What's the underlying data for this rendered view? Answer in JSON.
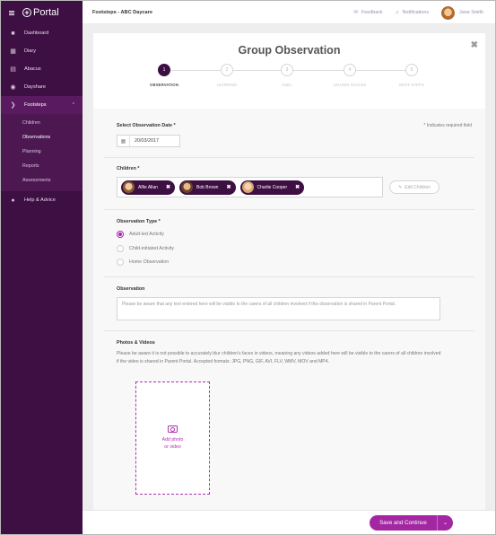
{
  "app": {
    "logo_text": "Portal"
  },
  "sidebar": {
    "items": [
      {
        "label": "Dashboard",
        "icon": "dashboard-icon"
      },
      {
        "label": "Diary",
        "icon": "calendar-icon"
      },
      {
        "label": "Abacus",
        "icon": "abacus-icon"
      },
      {
        "label": "Dayshare",
        "icon": "dayshare-icon"
      },
      {
        "label": "Footsteps",
        "icon": "footsteps-icon"
      },
      {
        "label": "Help & Advice",
        "icon": "help-icon"
      }
    ],
    "footsteps_sub": [
      "Children",
      "Observations",
      "Planning",
      "Reports",
      "Assessments"
    ]
  },
  "topbar": {
    "title": "Footsteps - ABC Daycare",
    "feedback": "Feedback",
    "notifications": "Notifications",
    "user_name": "Jane Smith"
  },
  "page": {
    "heading": "Group Observation",
    "steps": [
      {
        "number": "1",
        "label": "OBSERVATION"
      },
      {
        "number": "2",
        "label": "LEARNING"
      },
      {
        "number": "3",
        "label": "GoEL"
      },
      {
        "number": "4",
        "label": "LEUVEN SCALES"
      },
      {
        "number": "5",
        "label": "NEXT STEPS"
      }
    ],
    "active_step": 1
  },
  "form": {
    "date_label": "Select Observation Date *",
    "required_note": "* Indicates required field",
    "date_value": "20/03/2017",
    "children_label": "Children *",
    "children": [
      "Alfie Allan",
      "Bob Brown",
      "Charlie Cooper"
    ],
    "edit_children": "Edit Children",
    "type_label": "Observation Type *",
    "types": [
      "Adult-led Activity",
      "Child-initiated Activity",
      "Home Observation"
    ],
    "selected_type": "Adult-led Activity",
    "observation_label": "Observation",
    "observation_placeholder": "Please be aware that any text entered here will be visible to the carers of all children involved if this observation is shared in Parent Portal.",
    "photos_label": "Photos & Videos",
    "photos_note": "Please be aware it is not possible to accurately blur children's faces in videos, meaning any videos added here will be visible to the carers of all children involved if the video is shared in Parent Portal. Accepted formats: JPG, PNG, GIF, AVI, FLV, WMV, MOV and MP4.",
    "add_photo_line1": "Add photo",
    "add_photo_line2": "or video"
  },
  "footer": {
    "save_label": "Save and Continue"
  },
  "colors": {
    "sidebar": "#3d0f42",
    "accent": "#a327a3"
  }
}
